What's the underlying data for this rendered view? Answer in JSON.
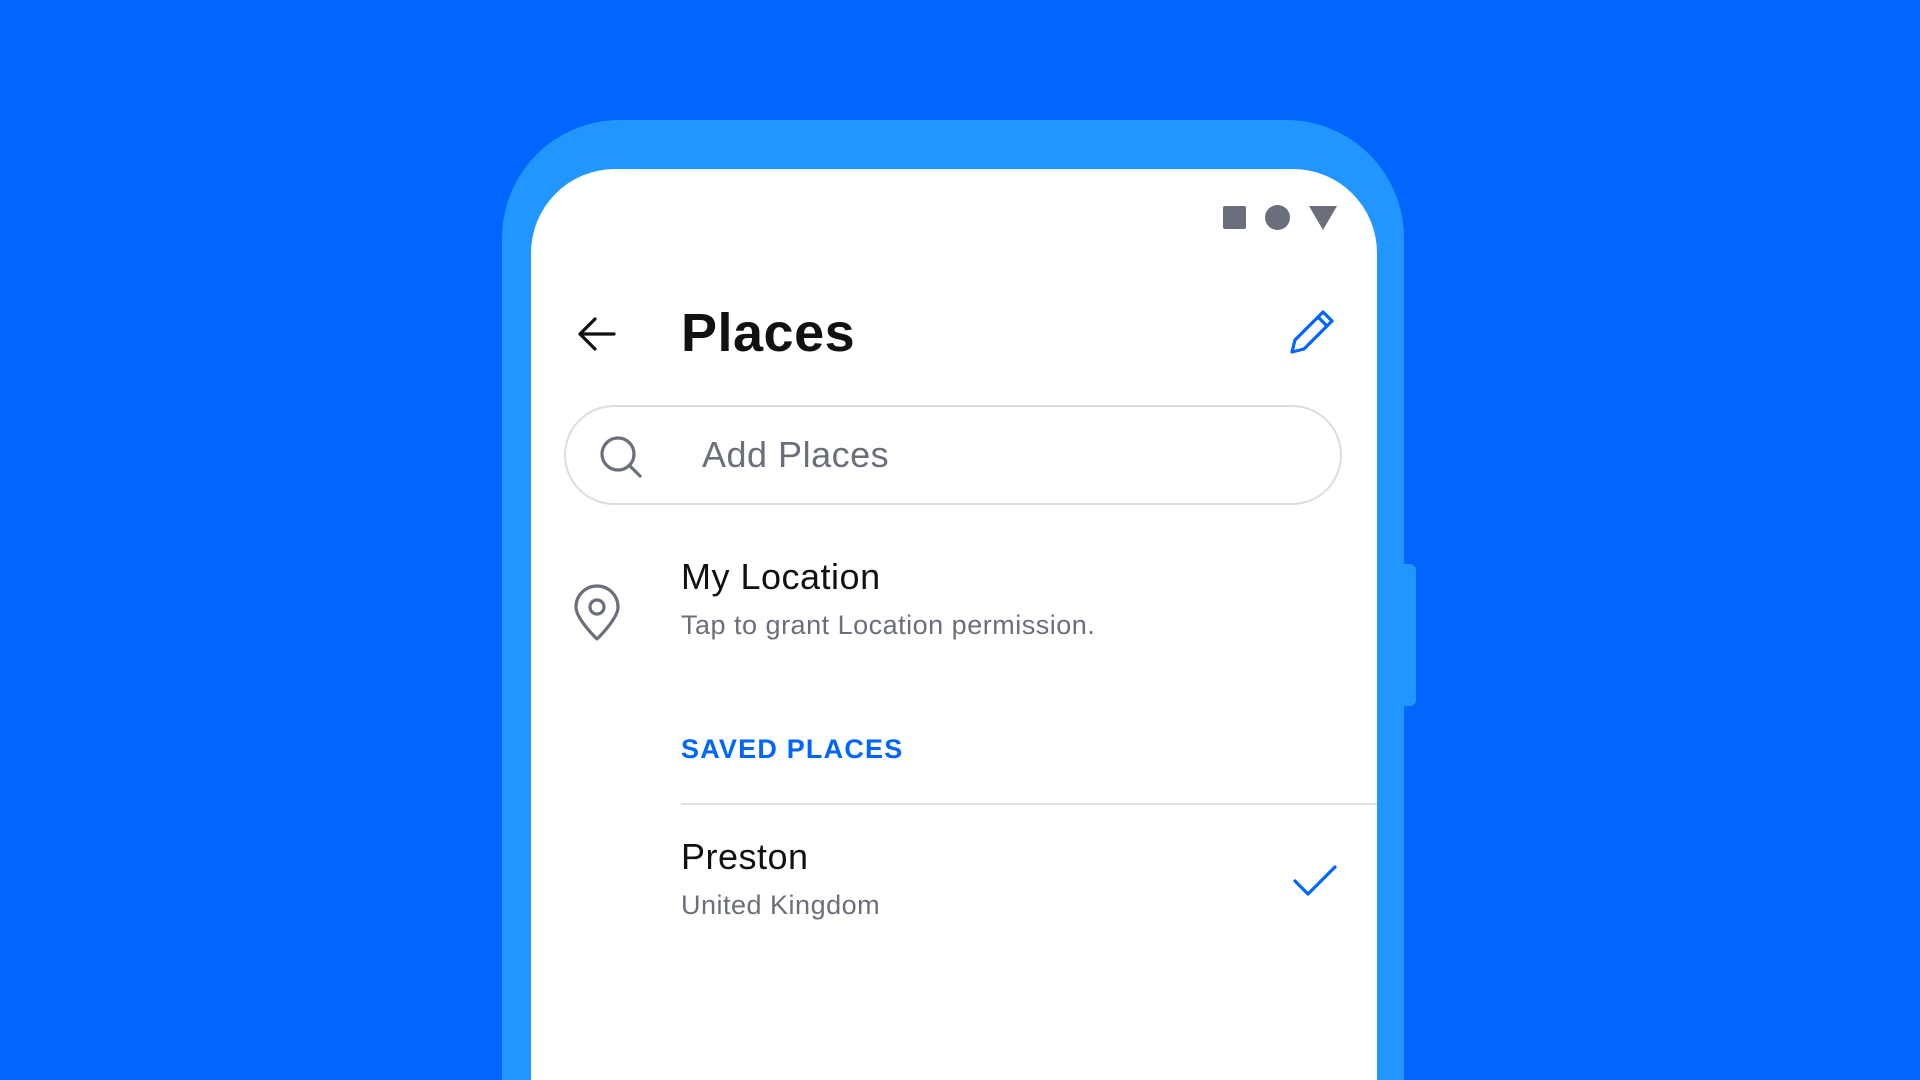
{
  "colors": {
    "background": "#0066FF",
    "phone_frame": "#2196FF",
    "accent": "#0066FF",
    "text_primary": "#111111",
    "text_secondary": "#6B6F7B"
  },
  "status_bar": {
    "icons": [
      "square-icon",
      "circle-icon",
      "triangle-icon"
    ]
  },
  "header": {
    "back_icon": "arrow-left-icon",
    "title": "Places",
    "edit_icon": "pencil-icon"
  },
  "search": {
    "icon": "search-icon",
    "placeholder": "Add Places",
    "value": ""
  },
  "my_location": {
    "icon": "map-pin-icon",
    "title": "My Location",
    "subtitle": "Tap to grant Location permission."
  },
  "saved_places": {
    "header": "SAVED PLACES",
    "items": [
      {
        "name": "Preston",
        "country": "United Kingdom",
        "selected_icon": "checkmark-icon"
      }
    ]
  }
}
